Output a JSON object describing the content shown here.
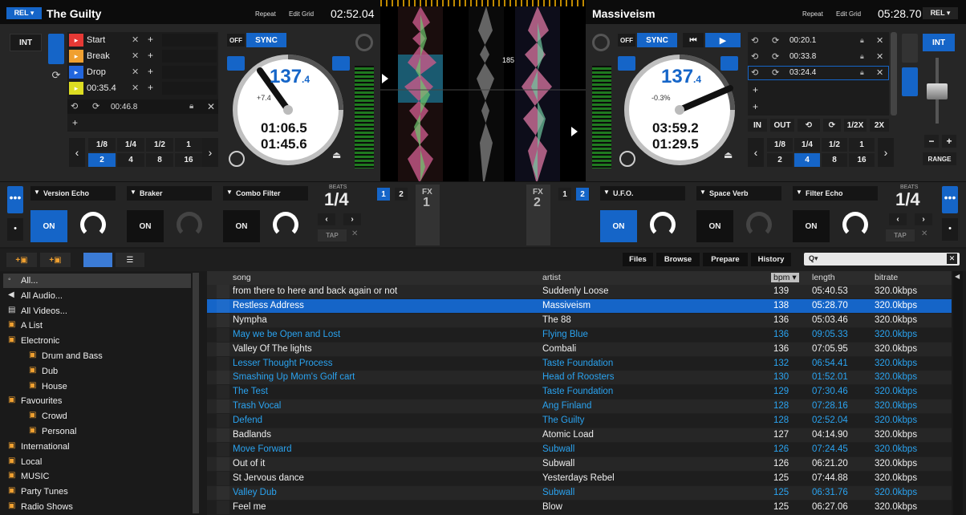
{
  "left_deck": {
    "rel_label": "REL ▾",
    "title": "The Guilty",
    "repeat": "Repeat",
    "edit_grid": "Edit Grid",
    "time": "02:52.04",
    "int_label": "INT",
    "off_label": "OFF",
    "sync_label": "SYNC",
    "bpm": "137",
    "bpm_dec": ".4",
    "pitch": "+7.4",
    "elapsed": "01:06.5",
    "remain": "01:45.6",
    "cues": [
      {
        "label": "Start",
        "color": "#e53935"
      },
      {
        "label": "Break",
        "color": "#f0a030"
      },
      {
        "label": "Drop",
        "color": "#2266dd"
      },
      {
        "label": "00:35.4",
        "color": "#dddd22"
      }
    ],
    "loop_time": "00:46.8",
    "loop_sizes": [
      "1/8",
      "1/4",
      "1/2",
      "1",
      "2",
      "4",
      "8",
      "16"
    ]
  },
  "right_deck": {
    "rel_label": "REL ▾",
    "title": "Massiveism",
    "repeat": "Repeat",
    "edit_grid": "Edit Grid",
    "time": "05:28.70",
    "int_label": "INT",
    "off_label": "OFF",
    "sync_label": "SYNC",
    "bpm": "137",
    "bpm_dec": ".4",
    "pitch": "-0.3%",
    "elapsed": "03:59.2",
    "remain": "01:29.5",
    "cues": [
      "00:20.1",
      "00:33.8",
      "03:24.4"
    ],
    "loop_btns": [
      "IN",
      "OUT",
      "1/2X",
      "2X"
    ],
    "loop_sizes": [
      "1/8",
      "1/4",
      "1/2",
      "1",
      "2",
      "4",
      "8",
      "16"
    ],
    "range_label": "RANGE",
    "minus": "−",
    "plus": "+"
  },
  "center": {
    "bpm_marker": "185"
  },
  "fx_left": {
    "slots": [
      "Version Echo",
      "Braker",
      "Combo Filter"
    ],
    "on_label": "ON",
    "beats_label": "BEATS",
    "beats_value": "1/4",
    "tap_label": "TAP",
    "fx_label": "FX",
    "fx_num": "1",
    "btn1": "1",
    "btn2": "2"
  },
  "fx_right": {
    "slots": [
      "U.F.O.",
      "Space Verb",
      "Filter Echo"
    ],
    "on_label": "ON",
    "beats_label": "BEATS",
    "beats_value": "1/4",
    "tap_label": "TAP",
    "fx_label": "FX",
    "fx_num": "2",
    "btn1": "1",
    "btn2": "2"
  },
  "browser": {
    "tabs": [
      "Files",
      "Browse",
      "Prepare",
      "History"
    ],
    "search_placeholder": "",
    "search_icon": "Q▾",
    "columns": [
      "song",
      "artist",
      "bpm ▾",
      "length",
      "bitrate"
    ],
    "tree": [
      {
        "label": "All...",
        "indent": 0,
        "icon": "circle-icon"
      },
      {
        "label": "All Audio...",
        "indent": 0,
        "icon": "speaker-icon"
      },
      {
        "label": "All Videos...",
        "indent": 0,
        "icon": "video-icon"
      },
      {
        "label": "A List",
        "indent": 0,
        "icon": "cube-icon"
      },
      {
        "label": "Electronic",
        "indent": 0,
        "icon": "cubes-icon"
      },
      {
        "label": "Drum and Bass",
        "indent": 1,
        "icon": "cube-icon"
      },
      {
        "label": "Dub",
        "indent": 1,
        "icon": "cube-icon"
      },
      {
        "label": "House",
        "indent": 1,
        "icon": "cube-icon"
      },
      {
        "label": "Favourites",
        "indent": 0,
        "icon": "cubes-icon"
      },
      {
        "label": "Crowd",
        "indent": 1,
        "icon": "cube-icon"
      },
      {
        "label": "Personal",
        "indent": 1,
        "icon": "cube-icon"
      },
      {
        "label": "International",
        "indent": 0,
        "icon": "cube-icon"
      },
      {
        "label": "Local",
        "indent": 0,
        "icon": "cube-icon"
      },
      {
        "label": "MUSIC",
        "indent": 0,
        "icon": "cube-icon"
      },
      {
        "label": "Party Tunes",
        "indent": 0,
        "icon": "cube-icon"
      },
      {
        "label": "Radio Shows",
        "indent": 0,
        "icon": "cube-icon"
      }
    ],
    "tracks": [
      {
        "song": "from there to here and back again or not",
        "artist": "Suddenly Loose",
        "bpm": "139",
        "length": "05:40.53",
        "bitrate": "320.0kbps",
        "style": "normal"
      },
      {
        "song": "Restless Address",
        "artist": "Massiveism",
        "bpm": "138",
        "length": "05:28.70",
        "bitrate": "320.0kbps",
        "style": "selected"
      },
      {
        "song": "Nympha",
        "artist": "The 88",
        "bpm": "136",
        "length": "05:03.46",
        "bitrate": "320.0kbps",
        "style": "normal"
      },
      {
        "song": "May we be Open and Lost",
        "artist": "Flying Blue",
        "bpm": "136",
        "length": "09:05.33",
        "bitrate": "320.0kbps",
        "style": "blue"
      },
      {
        "song": "Valley Of The lights",
        "artist": "Combali",
        "bpm": "136",
        "length": "07:05.95",
        "bitrate": "320.0kbps",
        "style": "normal"
      },
      {
        "song": "Lesser Thought Process",
        "artist": "Taste Foundation",
        "bpm": "132",
        "length": "06:54.41",
        "bitrate": "320.0kbps",
        "style": "blue"
      },
      {
        "song": "Smashing Up Mom's Golf cart",
        "artist": "Head of Roosters",
        "bpm": "130",
        "length": "01:52.01",
        "bitrate": "320.0kbps",
        "style": "blue"
      },
      {
        "song": "The Test",
        "artist": "Taste Foundation",
        "bpm": "129",
        "length": "07:30.46",
        "bitrate": "320.0kbps",
        "style": "blue"
      },
      {
        "song": "Trash Vocal",
        "artist": "Ang Finland",
        "bpm": "128",
        "length": "07:28.16",
        "bitrate": "320.0kbps",
        "style": "blue"
      },
      {
        "song": "Defend",
        "artist": "The Guilty",
        "bpm": "128",
        "length": "02:52.04",
        "bitrate": "320.0kbps",
        "style": "blue"
      },
      {
        "song": "Badlands",
        "artist": "Atomic Load",
        "bpm": "127",
        "length": "04:14.90",
        "bitrate": "320.0kbps",
        "style": "normal"
      },
      {
        "song": "Move Forward",
        "artist": "Subwall",
        "bpm": "126",
        "length": "07:24.45",
        "bitrate": "320.0kbps",
        "style": "blue"
      },
      {
        "song": "Out of it",
        "artist": "Subwall",
        "bpm": "126",
        "length": "06:21.20",
        "bitrate": "320.0kbps",
        "style": "normal"
      },
      {
        "song": "St Jervous dance",
        "artist": "Yesterdays Rebel",
        "bpm": "125",
        "length": "07:44.88",
        "bitrate": "320.0kbps",
        "style": "normal"
      },
      {
        "song": "Valley Dub",
        "artist": "Subwall",
        "bpm": "125",
        "length": "06:31.76",
        "bitrate": "320.0kbps",
        "style": "blue"
      },
      {
        "song": "Feel me",
        "artist": "Blow",
        "bpm": "125",
        "length": "06:27.06",
        "bitrate": "320.0kbps",
        "style": "normal"
      }
    ]
  },
  "colors": {
    "accent": "#1565c8",
    "track_blue": "#2aa3f0",
    "selected_row": "#1565c8"
  }
}
